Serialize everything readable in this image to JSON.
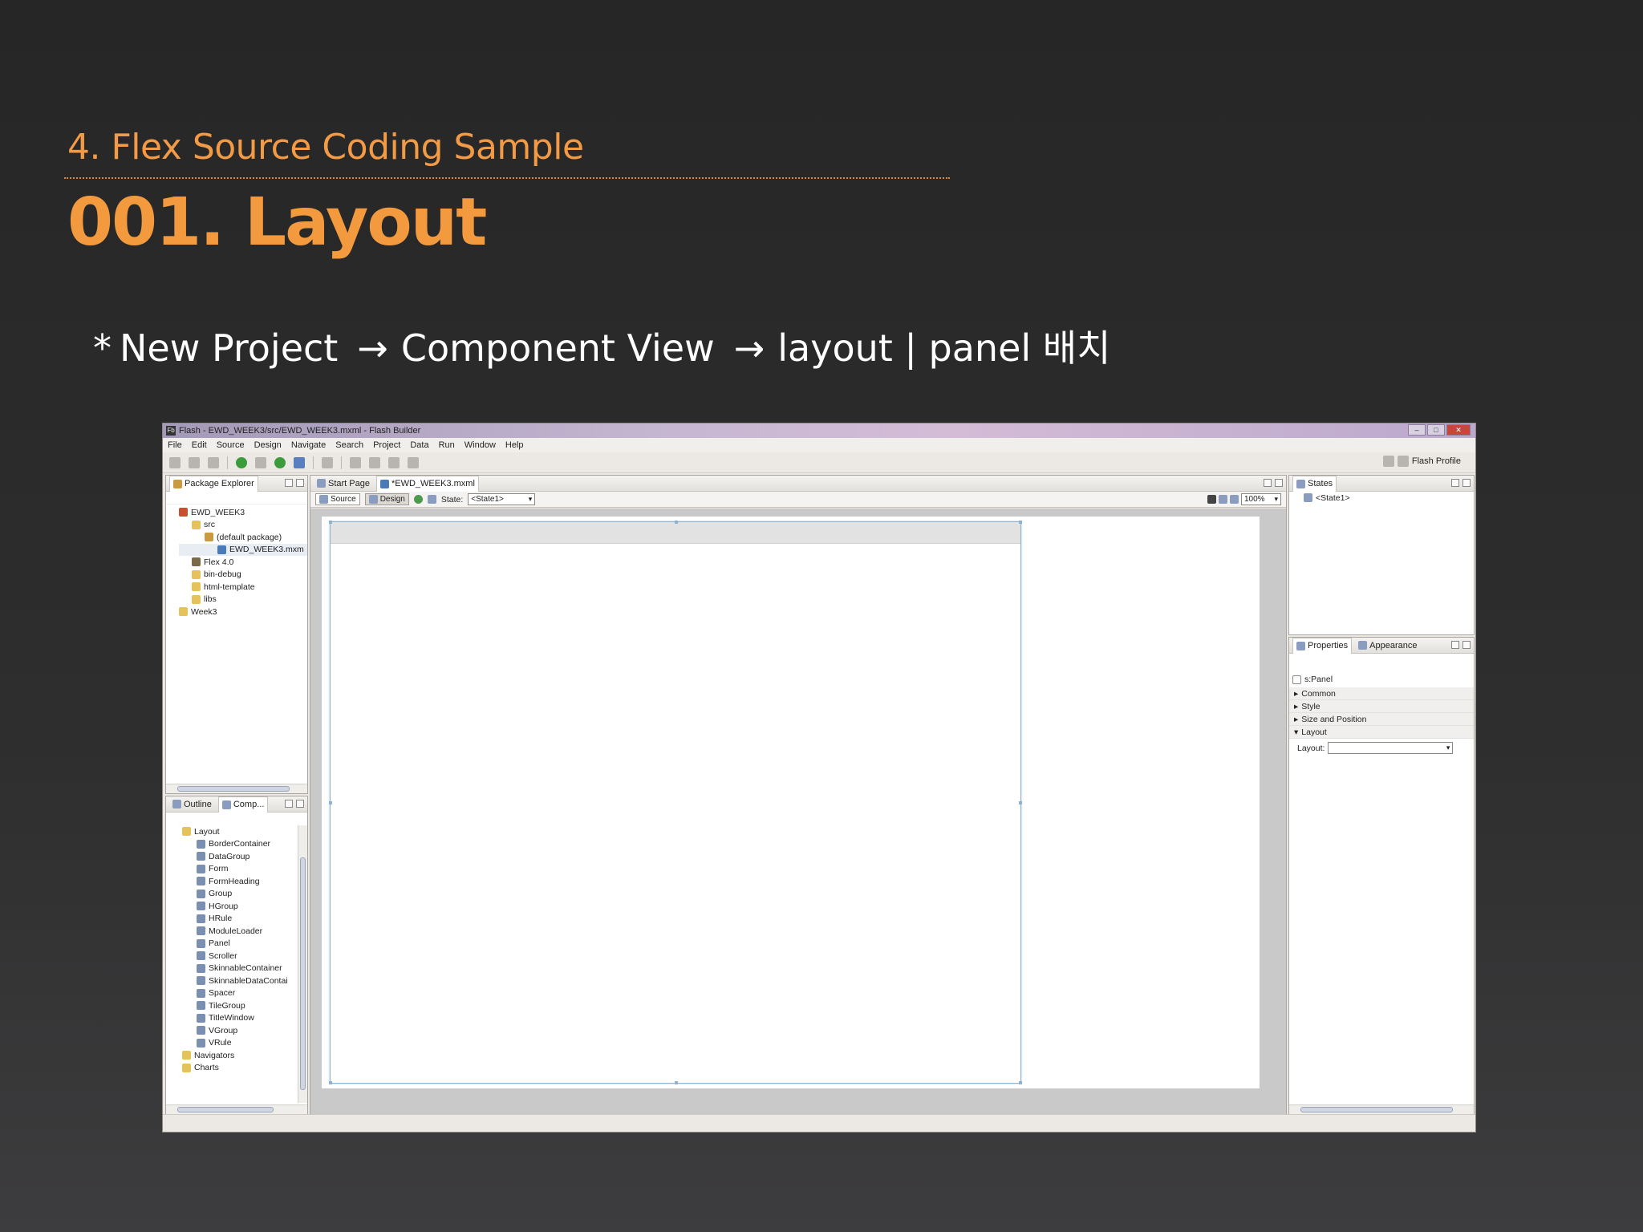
{
  "slide": {
    "subtitle": "4. Flex Source Coding Sample",
    "title": "001. Layout",
    "bullet": {
      "star": "*",
      "step1": "New Project",
      "arrow": "→",
      "step2": "Component View",
      "step3": "layout | panel  배치"
    }
  },
  "window": {
    "app_icon": "Fb",
    "title": "Flash - EWD_WEEK3/src/EWD_WEEK3.mxml - Flash Builder",
    "buttons": [
      "–",
      "□",
      "✕"
    ]
  },
  "menu": [
    "File",
    "Edit",
    "Source",
    "Design",
    "Navigate",
    "Search",
    "Project",
    "Data",
    "Run",
    "Window",
    "Help"
  ],
  "toolbar": {
    "perspective_label": "Flash Profile"
  },
  "package_explorer": {
    "tab": "Package Explorer",
    "items": [
      {
        "label": "EWD_WEEK3",
        "icon": "project-icon"
      },
      {
        "label": "src",
        "icon": "folder-icon"
      },
      {
        "label": "(default package)",
        "icon": "package-icon"
      },
      {
        "label": "EWD_WEEK3.mxm",
        "icon": "mxml-file-icon"
      },
      {
        "label": "Flex 4.0",
        "icon": "library-icon"
      },
      {
        "label": "bin-debug",
        "icon": "folder-icon"
      },
      {
        "label": "html-template",
        "icon": "folder-icon"
      },
      {
        "label": "libs",
        "icon": "folder-icon"
      },
      {
        "label": "Week3",
        "icon": "folder-icon"
      }
    ]
  },
  "components_view": {
    "tabs": [
      "Outline",
      "Comp..."
    ],
    "category": "Layout",
    "items": [
      "BorderContainer",
      "DataGroup",
      "Form",
      "FormHeading",
      "Group",
      "HGroup",
      "HRule",
      "ModuleLoader",
      "Panel",
      "Scroller",
      "SkinnableContainer",
      "SkinnableDataContai",
      "Spacer",
      "TileGroup",
      "TitleWindow",
      "VGroup",
      "VRule"
    ],
    "other_categories": [
      "Navigators",
      "Charts"
    ]
  },
  "editor": {
    "tabs": [
      "Start Page",
      "*EWD_WEEK3.mxml"
    ],
    "source_button": "Source",
    "design_button": "Design",
    "state_label": "State:",
    "state_value": "<State1>",
    "zoom": "100%"
  },
  "states_view": {
    "tab": "States",
    "items": [
      "<State1>"
    ]
  },
  "properties_view": {
    "tabs": [
      "Properties",
      "Appearance"
    ],
    "component": "s:Panel",
    "sections": [
      "Common",
      "Style",
      "Size and Position",
      "Layout"
    ],
    "layout_label": "Layout:",
    "layout_value": ""
  }
}
